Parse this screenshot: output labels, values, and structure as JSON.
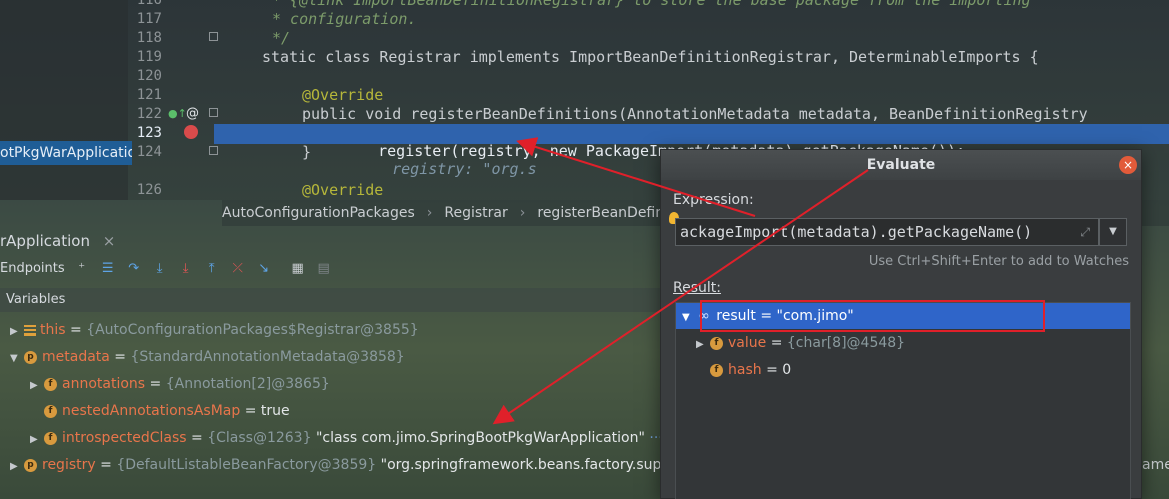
{
  "editor": {
    "lines": [
      {
        "num": "116",
        "text": "* {@link ImportBeanDefinitionRegistrar} to store the base package from the importing"
      },
      {
        "num": "117",
        "text": "* configuration."
      },
      {
        "num": "118",
        "text": "*/"
      },
      {
        "num": "119",
        "text": "static class Registrar implements ImportBeanDefinitionRegistrar, DeterminableImports {"
      },
      {
        "num": "120",
        "text": ""
      },
      {
        "num": "121",
        "text": "@Override"
      },
      {
        "num": "122",
        "text": "public void registerBeanDefinitions(AnnotationMetadata metadata, BeanDefinitionRegistry"
      },
      {
        "num": "123",
        "text": "register(registry, new PackageImport(metadata).getPackageName());",
        "inlay": "registry: \"org.s"
      },
      {
        "num": "124",
        "text": "}"
      },
      {
        "num": "126",
        "text": "@Override"
      }
    ],
    "left_chip": "otPkgWarApplicatio"
  },
  "breadcrumb": [
    "AutoConfigurationPackages",
    "Registrar",
    "registerBeanDefinit"
  ],
  "debug": {
    "title": "rApplication",
    "close": "×",
    "toolbar_label": "Endpoints",
    "variables_header": "Variables",
    "variables": [
      {
        "name": "this",
        "ref": "{AutoConfigurationPackages$Registrar@3855}",
        "value": ""
      },
      {
        "name": "metadata",
        "ref": "{StandardAnnotationMetadata@3858}",
        "value": ""
      },
      {
        "name": "annotations",
        "ref": "{Annotation[2]@3865}",
        "value": ""
      },
      {
        "name": "nestedAnnotationsAsMap",
        "ref": "",
        "value": "true"
      },
      {
        "name": "introspectedClass",
        "ref": "{Class@1263}",
        "value": "\"class com.jimo.SpringBootPkgWarApplication\"",
        "nav": "··· N"
      },
      {
        "name": "registry",
        "ref": "{DefaultListableBeanFactory@3859}",
        "value": "\"org.springframework.beans.factory.suppo",
        "tail": "ame"
      }
    ]
  },
  "evaluate": {
    "title": "Evaluate",
    "expression_label": "Expression:",
    "expression": "ackageImport(metadata).getPackageName()",
    "hint": "Use Ctrl+Shift+Enter to add to Watches",
    "result_label": "Result:",
    "result": {
      "text": "result = \"com.jimo\""
    },
    "children": [
      {
        "name": "value",
        "ref": "{char[8]@4548}"
      },
      {
        "name": "hash",
        "value": "0"
      }
    ]
  },
  "colors": {
    "accent_selection": "#2f65c9",
    "annotation_red": "#e0202a",
    "field_name": "#e8754b"
  }
}
